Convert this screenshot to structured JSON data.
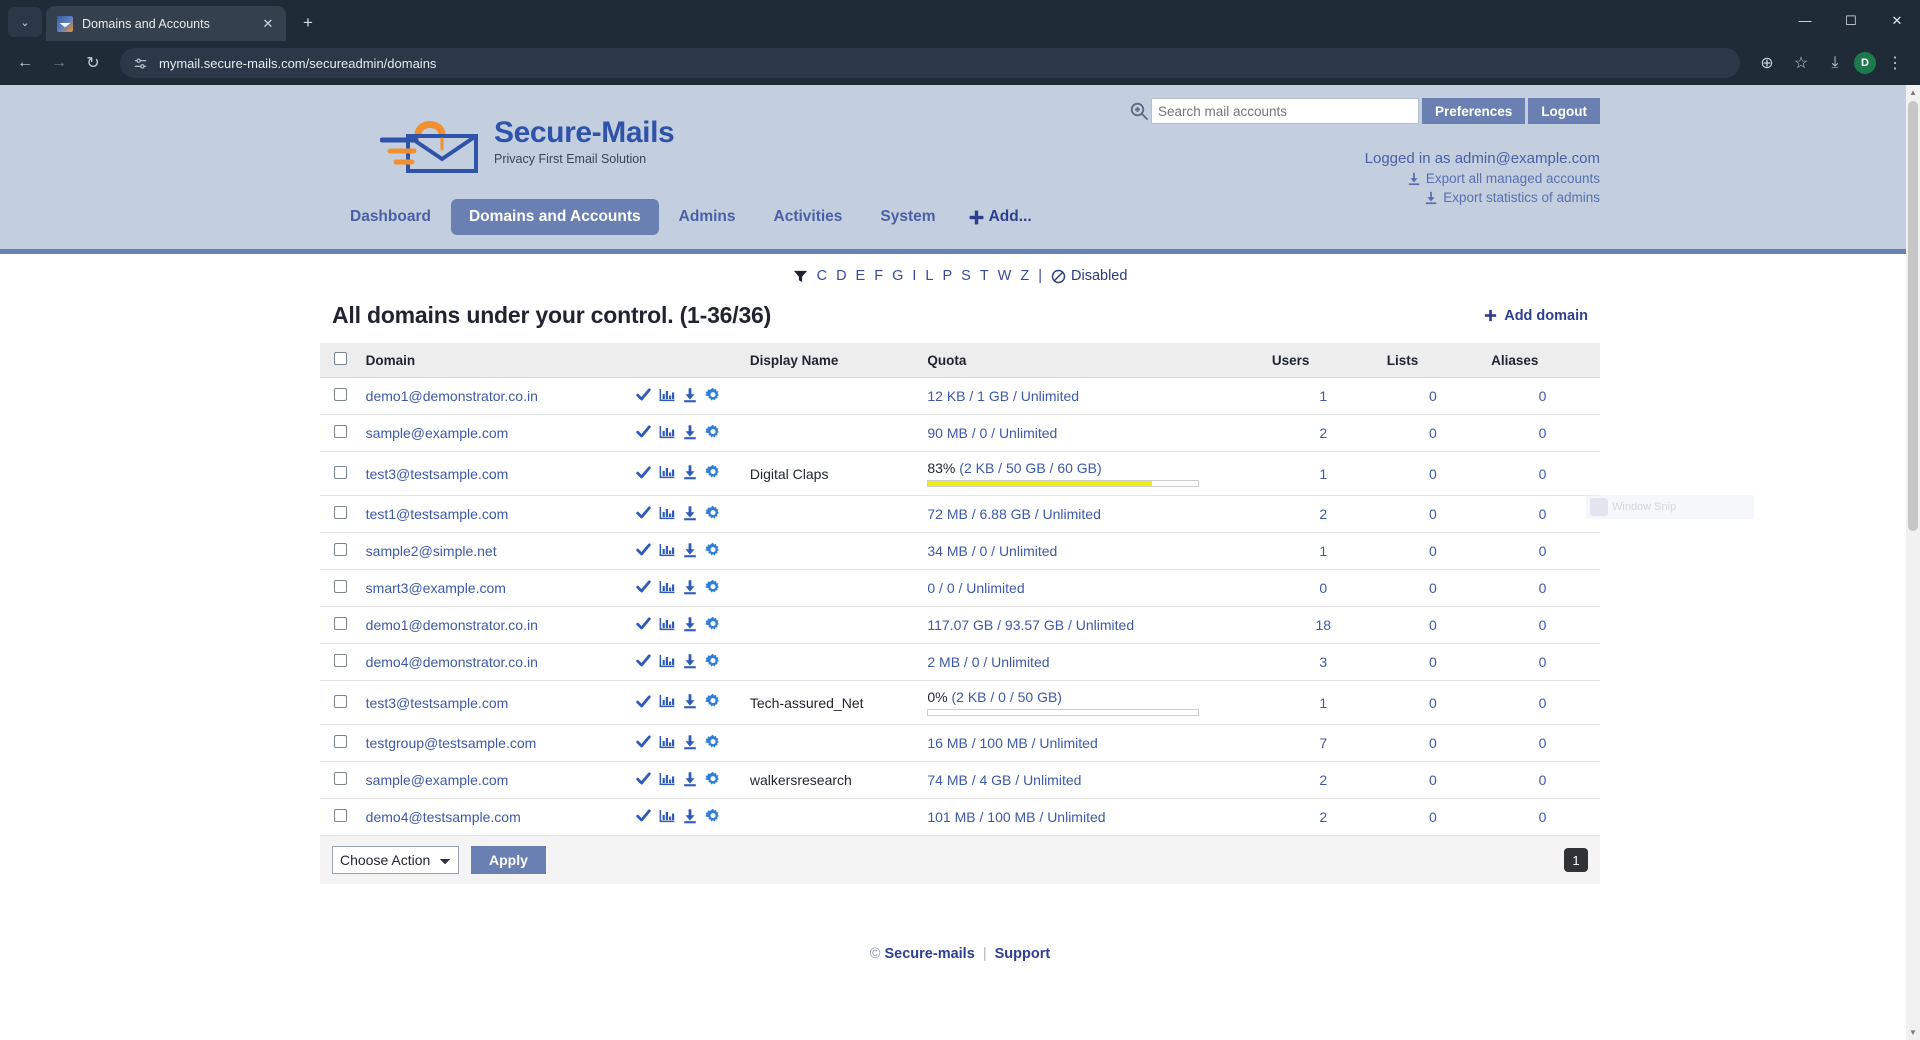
{
  "browser": {
    "tab_title": "Domains and Accounts",
    "tab_close": "✕",
    "new_tab": "+",
    "tab_menu_caret": "⌄",
    "back": "←",
    "forward": "→",
    "reload": "↻",
    "url": "mymail.secure-mails.com/secureadmin/domains",
    "zoom_icon": "⊕",
    "bookmark_icon": "☆",
    "download_icon": "⤓",
    "profile_initial": "D",
    "menu_icon": "⋮",
    "minimize": "—",
    "maximize": "☐",
    "close": "✕"
  },
  "header": {
    "logo_name": "Secure-Mails",
    "logo_tagline": "Privacy First Email Solution",
    "search_placeholder": "Search mail accounts",
    "search_value": "",
    "preferences_label": "Preferences",
    "logout_label": "Logout",
    "logged_in_as": "Logged in as admin@example.com",
    "export_accounts": "Export all managed accounts",
    "export_statistics": "Export statistics of admins",
    "nav": [
      {
        "label": "Dashboard",
        "active": false
      },
      {
        "label": "Domains and Accounts",
        "active": true
      },
      {
        "label": "Admins",
        "active": false
      },
      {
        "label": "Activities",
        "active": false
      },
      {
        "label": "System",
        "active": false
      }
    ],
    "nav_add_label": "Add...",
    "nav_add_icon": "+"
  },
  "filter_bar": {
    "filter_icon": "funnel-icon",
    "letters": [
      "C",
      "D",
      "E",
      "F",
      "G",
      "I",
      "L",
      "P",
      "S",
      "T",
      "W",
      "Z"
    ],
    "separator": "|",
    "disabled_label": "Disabled",
    "disabled_icon": "no-entry-icon"
  },
  "list": {
    "title": "All domains under your control. (1-36/36)",
    "add_domain_label": "Add domain",
    "add_domain_icon": "+",
    "columns": [
      "Domain",
      "Display Name",
      "Quota",
      "Users",
      "Lists",
      "Aliases"
    ],
    "row_icons": [
      "check-icon",
      "statistics-icon",
      "download-icon",
      "gear-icon"
    ],
    "rows": [
      {
        "domain": "demo1@demonstrator.co.in",
        "display_name": "",
        "quota": "12 KB / 1 GB / Unlimited",
        "quota_pct": null,
        "users": "1",
        "lists": "0",
        "aliases": "0"
      },
      {
        "domain": "sample@example.com",
        "display_name": "",
        "quota": "90 MB / 0 / Unlimited",
        "quota_pct": null,
        "users": "2",
        "lists": "0",
        "aliases": "0"
      },
      {
        "domain": "test3@testsample.com",
        "display_name": "Digital Claps",
        "quota": "(2 KB / 50 GB / 60 GB)",
        "quota_pct": "83%",
        "quota_pct_value": 83,
        "users": "1",
        "lists": "0",
        "aliases": "0"
      },
      {
        "domain": "test1@testsample.com",
        "display_name": "",
        "quota": "72 MB / 6.88 GB / Unlimited",
        "quota_pct": null,
        "users": "2",
        "lists": "0",
        "aliases": "0"
      },
      {
        "domain": "sample2@simple.net",
        "display_name": "",
        "quota": "34 MB / 0 / Unlimited",
        "quota_pct": null,
        "users": "1",
        "lists": "0",
        "aliases": "0"
      },
      {
        "domain": "smart3@example.com",
        "display_name": "",
        "quota": "0 / 0 / Unlimited",
        "quota_pct": null,
        "users": "0",
        "lists": "0",
        "aliases": "0"
      },
      {
        "domain": "demo1@demonstrator.co.in",
        "display_name": "",
        "quota": "117.07 GB / 93.57 GB / Unlimited",
        "quota_pct": null,
        "users": "18",
        "lists": "0",
        "aliases": "0"
      },
      {
        "domain": "demo4@demonstrator.co.in",
        "display_name": "",
        "quota": "2 MB / 0 / Unlimited",
        "quota_pct": null,
        "users": "3",
        "lists": "0",
        "aliases": "0"
      },
      {
        "domain": "test3@testsample.com",
        "display_name": "Tech-assured_Net",
        "quota": "(2 KB / 0 / 50 GB)",
        "quota_pct": "0%",
        "quota_pct_value": 0,
        "users": "1",
        "lists": "0",
        "aliases": "0"
      },
      {
        "domain": "testgroup@testsample.com",
        "display_name": "",
        "quota": "16 MB / 100 MB / Unlimited",
        "quota_pct": null,
        "users": "7",
        "lists": "0",
        "aliases": "0"
      },
      {
        "domain": "sample@example.com",
        "display_name": "walkersresearch",
        "quota": "74 MB / 4 GB / Unlimited",
        "quota_pct": null,
        "users": "2",
        "lists": "0",
        "aliases": "0"
      },
      {
        "domain": "demo4@testsample.com",
        "display_name": "",
        "quota": "101 MB / 100 MB / Unlimited",
        "quota_pct": null,
        "users": "2",
        "lists": "0",
        "aliases": "0"
      }
    ]
  },
  "footer_controls": {
    "action_selected": "Choose Action",
    "apply_label": "Apply",
    "page_number": "1"
  },
  "page_footer": {
    "copyright": "©",
    "brand": "Secure-mails",
    "divider": "|",
    "support": "Support"
  },
  "overlay": {
    "snip_label": "Window Snip"
  },
  "colors": {
    "header_bg": "#c3cfdf",
    "accent": "#6a80b3",
    "link": "#3d5aa8",
    "quota_bar": "#eded18",
    "logo_blue": "#2e53a8",
    "logo_orange": "#f28f2e"
  }
}
